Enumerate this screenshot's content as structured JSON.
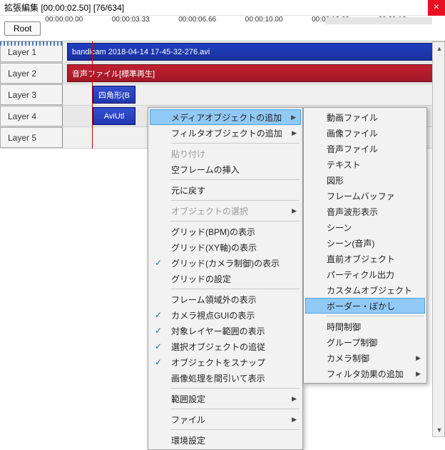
{
  "title": "拡張編集 [00:00:02.50] [76/634]",
  "root_btn": "Root",
  "ruler": [
    "00:00:00.00",
    "00:00:03.33",
    "00:00:06.66",
    "00:00:10.00",
    "00:00:13.33",
    "00:00:16"
  ],
  "layers": [
    "Layer 1",
    "Layer 2",
    "Layer 3",
    "Layer 4",
    "Layer 5"
  ],
  "clips": {
    "l1": "bandicam 2018-04-14 17-45-32-276.avi",
    "l2": "音声ファイル[標準再生]",
    "l3": "四角形(B",
    "l4": "AviUtl"
  },
  "menu1": [
    {
      "t": "メディアオブジェクトの追加",
      "sub": true,
      "hover": true
    },
    {
      "t": "フィルタオブジェクトの追加",
      "sub": true
    },
    {
      "sep": true
    },
    {
      "t": "貼り付け",
      "disabled": true
    },
    {
      "t": "空フレームの挿入"
    },
    {
      "sep": true
    },
    {
      "t": "元に戻す"
    },
    {
      "sep": true
    },
    {
      "t": "オブジェクトの選択",
      "disabled": true,
      "sub": true
    },
    {
      "sep": true
    },
    {
      "t": "グリッド(BPM)の表示"
    },
    {
      "t": "グリッド(XY軸)の表示"
    },
    {
      "t": "グリッド(カメラ制御)の表示",
      "check": true
    },
    {
      "t": "グリッドの設定"
    },
    {
      "sep": true
    },
    {
      "t": "フレーム領域外の表示"
    },
    {
      "t": "カメラ視点GUIの表示",
      "check": true
    },
    {
      "t": "対象レイヤー範囲の表示",
      "check": true
    },
    {
      "t": "選択オブジェクトの追従",
      "check": true
    },
    {
      "t": "オブジェクトをスナップ",
      "check": true
    },
    {
      "t": "画像処理を間引いて表示"
    },
    {
      "sep": true
    },
    {
      "t": "範囲設定",
      "sub": true
    },
    {
      "sep": true
    },
    {
      "t": "ファイル",
      "sub": true
    },
    {
      "sep": true
    },
    {
      "t": "環境設定"
    }
  ],
  "menu2": [
    {
      "t": "動画ファイル"
    },
    {
      "t": "画像ファイル"
    },
    {
      "t": "音声ファイル"
    },
    {
      "t": "テキスト"
    },
    {
      "t": "図形"
    },
    {
      "t": "フレームバッファ"
    },
    {
      "t": "音声波形表示"
    },
    {
      "t": "シーン"
    },
    {
      "t": "シーン(音声)"
    },
    {
      "t": "直前オブジェクト"
    },
    {
      "t": "パーティクル出力"
    },
    {
      "t": "カスタムオブジェクト"
    },
    {
      "t": "ボーダー・ぼかし",
      "hover": true
    },
    {
      "sep": true
    },
    {
      "t": "時間制御"
    },
    {
      "t": "グループ制御"
    },
    {
      "t": "カメラ制御",
      "sub": true
    },
    {
      "t": "フィルタ効果の追加",
      "sub": true
    }
  ]
}
